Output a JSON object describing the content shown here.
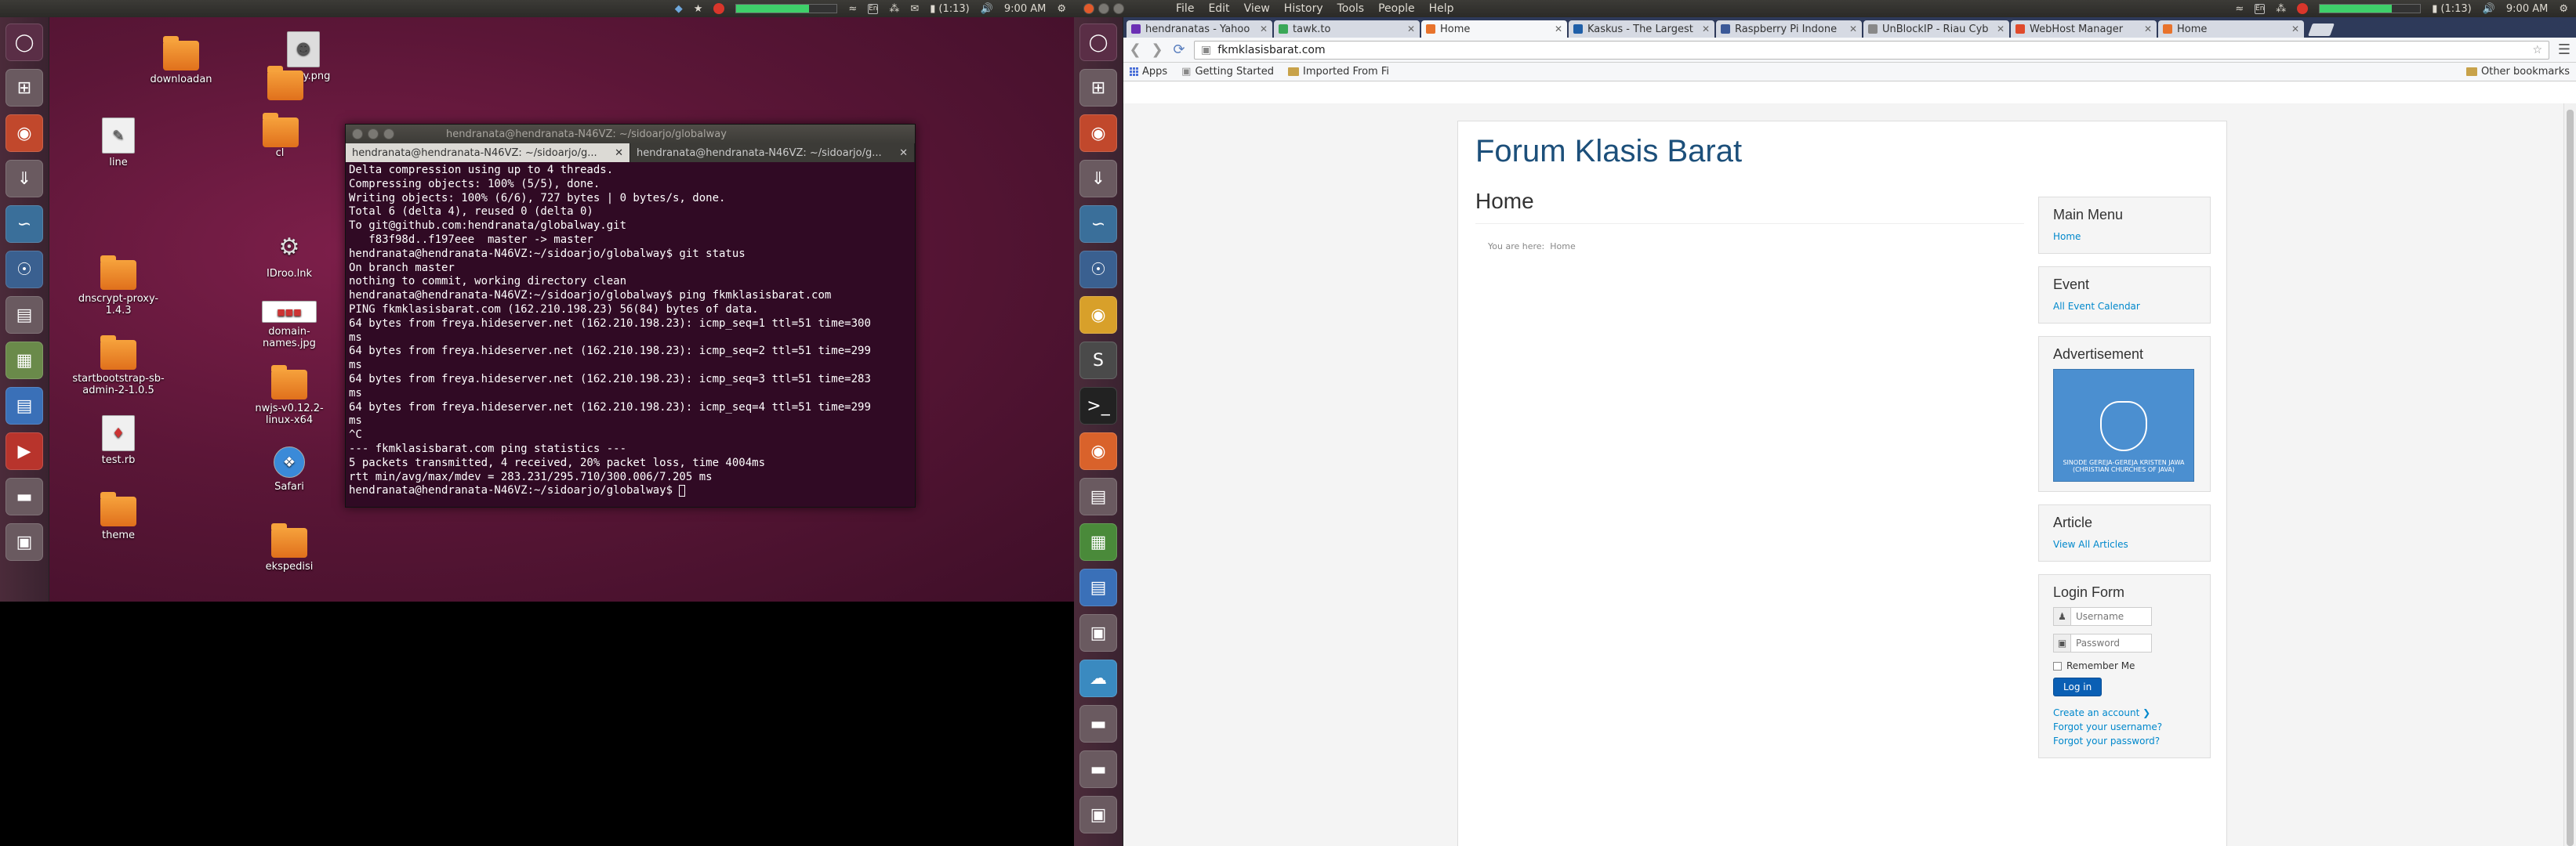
{
  "top_panel_left": {
    "indicators": {
      "battery_text": "(1:13)",
      "time": "9:00 AM",
      "lang": "En",
      "battery_pct": 0.72
    }
  },
  "top_panel_right": {
    "menus": [
      "File",
      "Edit",
      "View",
      "History",
      "Tools",
      "People",
      "Help"
    ],
    "indicators": {
      "battery_text": "(1:13)",
      "time": "9:00 AM",
      "lang": "En",
      "battery_pct": 0.72
    }
  },
  "desktop": {
    "icons": [
      {
        "label": "downloadan",
        "kind": "folder"
      },
      {
        "label": "empty.png",
        "kind": "image"
      },
      {
        "label": "line",
        "kind": "file"
      },
      {
        "label": "IDroo.lnk",
        "kind": "file"
      },
      {
        "label": "dnscrypt-proxy-1.4.3",
        "kind": "folder"
      },
      {
        "label": "domain-names.jpg",
        "kind": "image"
      },
      {
        "label": "startbootstrap-sb-admin-2-1.0.5",
        "kind": "folder"
      },
      {
        "label": "nwjs-v0.12.2-linux-x64",
        "kind": "folder"
      },
      {
        "label": "test.rb",
        "kind": "file"
      },
      {
        "label": "Safari",
        "kind": "file"
      },
      {
        "label": "theme",
        "kind": "folder"
      },
      {
        "label": "ekspedisi",
        "kind": "folder"
      },
      {
        "label": "cl",
        "kind": "folder"
      }
    ]
  },
  "terminal": {
    "title": "hendranata@hendranata-N46VZ: ~/sidoarjo/globalway",
    "tabs": [
      {
        "label": "hendranata@hendranata-N46VZ: ~/sidoarjo/g..."
      },
      {
        "label": "hendranata@hendranata-N46VZ: ~/sidoarjo/g..."
      }
    ],
    "lines": [
      "Delta compression using up to 4 threads.",
      "Compressing objects: 100% (5/5), done.",
      "Writing objects: 100% (6/6), 727 bytes | 0 bytes/s, done.",
      "Total 6 (delta 4), reused 0 (delta 0)",
      "To git@github.com:hendranata/globalway.git",
      "   f83f98d..f197eee  master -> master",
      "hendranata@hendranata-N46VZ:~/sidoarjo/globalway$ git status",
      "On branch master",
      "nothing to commit, working directory clean",
      "hendranata@hendranata-N46VZ:~/sidoarjo/globalway$ ping fkmklasisbarat.com",
      "PING fkmklasisbarat.com (162.210.198.23) 56(84) bytes of data.",
      "64 bytes from freya.hideserver.net (162.210.198.23): icmp_seq=1 ttl=51 time=300",
      "ms",
      "64 bytes from freya.hideserver.net (162.210.198.23): icmp_seq=2 ttl=51 time=299",
      "ms",
      "64 bytes from freya.hideserver.net (162.210.198.23): icmp_seq=3 ttl=51 time=283",
      "ms",
      "64 bytes from freya.hideserver.net (162.210.198.23): icmp_seq=4 ttl=51 time=299",
      "ms",
      "^C",
      "--- fkmklasisbarat.com ping statistics ---",
      "5 packets transmitted, 4 received, 20% packet loss, time 4004ms",
      "rtt min/avg/max/mdev = 283.231/295.710/300.006/7.205 ms",
      "hendranata@hendranata-N46VZ:~/sidoarjo/globalway$ "
    ]
  },
  "browser": {
    "tabs": [
      {
        "label": "hendranatas - Yahoo",
        "color": "#6b2fb4"
      },
      {
        "label": "tawk.to",
        "color": "#3aa757"
      },
      {
        "label": "Home",
        "color": "#e8732c",
        "active": true
      },
      {
        "label": "Kaskus - The Largest",
        "color": "#1f5fa8"
      },
      {
        "label": "Raspberry Pi Indone",
        "color": "#3b5998"
      },
      {
        "label": "UnBlockIP - Riau Cyb",
        "color": "#888888"
      },
      {
        "label": "WebHost Manager",
        "color": "#e04a2b"
      },
      {
        "label": "Home",
        "color": "#e8732c"
      }
    ],
    "address": "fkmklasisbarat.com",
    "bookmarks": {
      "apps": "Apps",
      "items": [
        "Getting Started",
        "Imported From Fi"
      ],
      "other": "Other bookmarks"
    }
  },
  "site": {
    "title": "Forum Klasis Barat",
    "page_heading": "Home",
    "breadcrumb_prefix": "You are here:",
    "breadcrumb_current": "Home",
    "modules": {
      "main_menu": {
        "title": "Main Menu",
        "link": "Home"
      },
      "event": {
        "title": "Event",
        "link": "All Event Calendar"
      },
      "advertisement": {
        "title": "Advertisement",
        "image_caption": "SINODE GEREJA-GEREJA KRISTEN JAWA (CHRISTIAN CHURCHES OF JAVA)"
      },
      "article": {
        "title": "Article",
        "link": "View All Articles"
      },
      "login": {
        "title": "Login Form",
        "username_placeholder": "Username",
        "password_placeholder": "Password",
        "remember": "Remember Me",
        "button": "Log in",
        "links": [
          "Create an account",
          "Forgot your username?",
          "Forgot your password?"
        ]
      }
    }
  }
}
